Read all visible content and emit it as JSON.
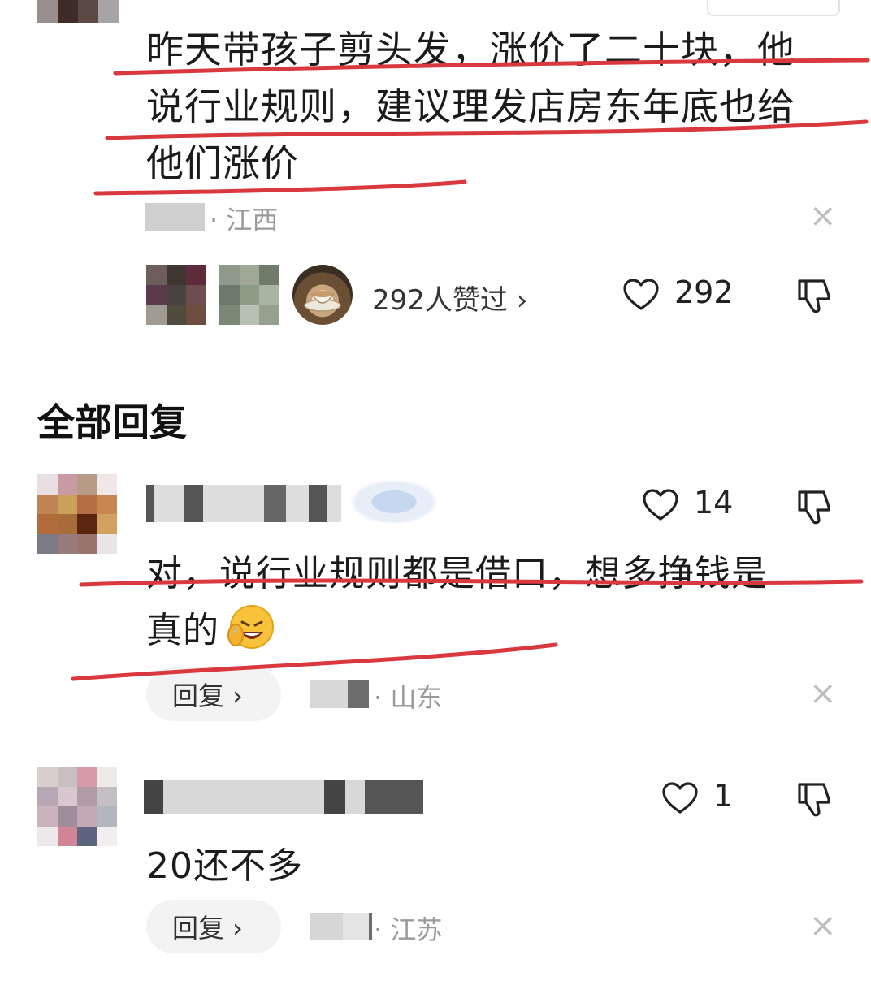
{
  "top_comment": {
    "text_lines": [
      "昨天带孩子剪头发，涨价了二十块，他",
      "说行业规则，建议理发店房东年底也给",
      "他们涨价"
    ],
    "location": "· 江西",
    "likers_summary": "292人赞过 ›",
    "like_count": "292",
    "close_glyph": "×"
  },
  "replies_section": {
    "title": "全部回复",
    "replies": [
      {
        "like_count": "14",
        "text": "对，说行业规则都是借口，想多挣钱是真的",
        "text_lines": [
          "对，说行业规则都是借口，想多挣钱是",
          "真的"
        ],
        "reply_label": "回复 ›",
        "location": "· 山东",
        "close_glyph": "×"
      },
      {
        "like_count": "1",
        "text": "20还不多",
        "reply_label": "回复 ›",
        "location": "· 江苏",
        "close_glyph": "×"
      }
    ]
  },
  "icons": {
    "like": "heart-outline-icon",
    "dislike": "thumbs-down-icon",
    "close": "close-icon",
    "emoji": "laughing-crying-emoji"
  },
  "colors": {
    "annotation_red": "#d9383f",
    "muted_text": "#9a9a9a",
    "reply_button_bg": "#f3f3f3"
  }
}
